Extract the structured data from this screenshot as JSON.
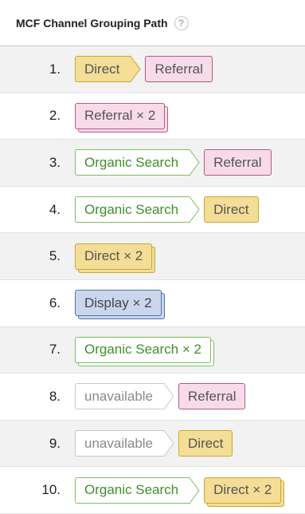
{
  "header": {
    "title": "MCF Channel Grouping Path",
    "help": "?"
  },
  "colors": {
    "Direct": {
      "bg": "#f4dd96",
      "border": "#c9a830",
      "text": "#555555"
    },
    "Referral": {
      "bg": "#f8dbe8",
      "border": "#b15a86",
      "text": "#555555"
    },
    "Organic Search": {
      "bg": "#ffffff",
      "border": "#7fbf5e",
      "text": "#3f8f2a"
    },
    "Display": {
      "bg": "#c9d6ee",
      "border": "#5470ad",
      "text": "#444444"
    },
    "unavailable": {
      "bg": "#ffffff",
      "border": "#c8c8c8",
      "text": "#8a8a8a"
    }
  },
  "rows": [
    {
      "num": "1.",
      "path": [
        {
          "channel": "Direct",
          "label": "Direct",
          "multi": false
        },
        {
          "channel": "Referral",
          "label": "Referral",
          "multi": false
        }
      ]
    },
    {
      "num": "2.",
      "path": [
        {
          "channel": "Referral",
          "label": "Referral × 2",
          "multi": true
        }
      ]
    },
    {
      "num": "3.",
      "path": [
        {
          "channel": "Organic Search",
          "label": "Organic Search",
          "multi": false
        },
        {
          "channel": "Referral",
          "label": "Referral",
          "multi": false
        }
      ]
    },
    {
      "num": "4.",
      "path": [
        {
          "channel": "Organic Search",
          "label": "Organic Search",
          "multi": false
        },
        {
          "channel": "Direct",
          "label": "Direct",
          "multi": false
        }
      ]
    },
    {
      "num": "5.",
      "path": [
        {
          "channel": "Direct",
          "label": "Direct × 2",
          "multi": true
        }
      ]
    },
    {
      "num": "6.",
      "path": [
        {
          "channel": "Display",
          "label": "Display × 2",
          "multi": true
        }
      ]
    },
    {
      "num": "7.",
      "path": [
        {
          "channel": "Organic Search",
          "label": "Organic Search × 2",
          "multi": true
        }
      ]
    },
    {
      "num": "8.",
      "path": [
        {
          "channel": "unavailable",
          "label": "unavailable",
          "multi": false
        },
        {
          "channel": "Referral",
          "label": "Referral",
          "multi": false
        }
      ]
    },
    {
      "num": "9.",
      "path": [
        {
          "channel": "unavailable",
          "label": "unavailable",
          "multi": false
        },
        {
          "channel": "Direct",
          "label": "Direct",
          "multi": false
        }
      ]
    },
    {
      "num": "10.",
      "path": [
        {
          "channel": "Organic Search",
          "label": "Organic Search",
          "multi": false
        },
        {
          "channel": "Direct",
          "label": "Direct × 2",
          "multi": true
        }
      ]
    }
  ]
}
